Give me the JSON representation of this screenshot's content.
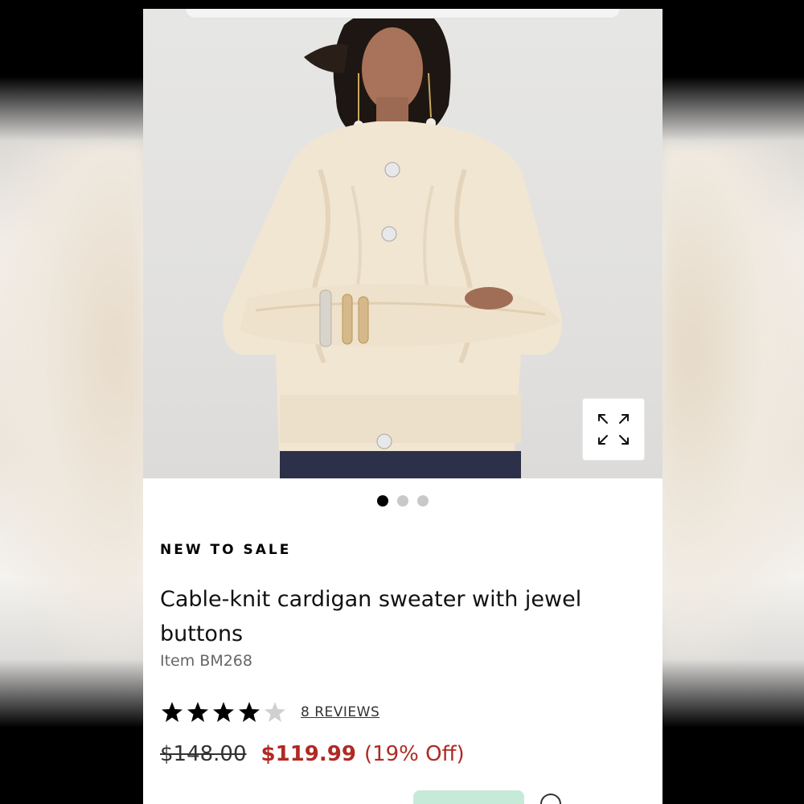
{
  "product": {
    "badge": "NEW TO SALE",
    "title": "Cable-knit cardigan sweater with jewel buttons",
    "item_number": "Item BM268",
    "image_alt": "Model wearing cream cable-knit cardigan with jewel buttons",
    "gallery": {
      "total": 3,
      "active": 1
    },
    "rating": {
      "stars": 4,
      "max": 5
    },
    "reviews_label": "8 REVIEWS",
    "original_price": "$148.00",
    "sale_price": "$119.99",
    "discount": "(19% Off)"
  },
  "icons": {
    "zoom": "expand-icon",
    "star_full": "star-filled-icon",
    "star_empty": "star-empty-icon"
  },
  "colors": {
    "sale": "#b02a24",
    "star_full": "#000000",
    "star_empty": "#d0d0d0"
  }
}
